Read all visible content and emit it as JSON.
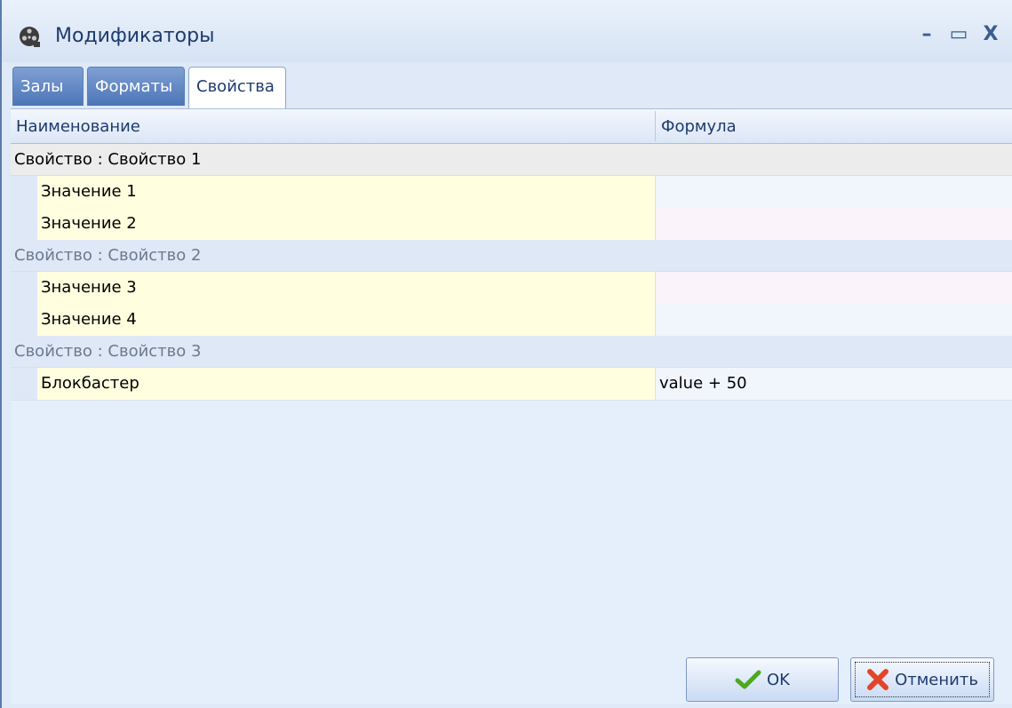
{
  "window": {
    "title": "Модификаторы",
    "app_icon": "film-reel-icon",
    "controls": {
      "minimize": "–",
      "maximize": "▭",
      "close": "X"
    }
  },
  "tabs": [
    {
      "label": "Залы",
      "active": false
    },
    {
      "label": "Форматы",
      "active": false
    },
    {
      "label": "Свойства",
      "active": true
    }
  ],
  "grid": {
    "columns": [
      "Наименование",
      "Формула"
    ],
    "groups": [
      {
        "label": "Свойство : Свойство 1",
        "rows": [
          {
            "name": "Значение 1",
            "formula": ""
          },
          {
            "name": "Значение 2",
            "formula": ""
          }
        ]
      },
      {
        "label": "Свойство : Свойство 2",
        "rows": [
          {
            "name": "Значение 3",
            "formula": ""
          },
          {
            "name": "Значение 4",
            "formula": ""
          }
        ]
      },
      {
        "label": "Свойство : Свойство 3",
        "rows": [
          {
            "name": "Блокбастер",
            "formula": "value + 50"
          }
        ]
      }
    ]
  },
  "buttons": {
    "ok": {
      "label": "OK",
      "icon": "checkmark-icon"
    },
    "cancel": {
      "label": "Отменить",
      "icon": "cross-icon"
    }
  },
  "colors": {
    "title_text": "#1e3b6e",
    "tab_inactive": "#4c74b6",
    "name_cell_bg": "#ffffe0",
    "ok_check": "#4caa1f",
    "cancel_cross": "#e2452a"
  }
}
